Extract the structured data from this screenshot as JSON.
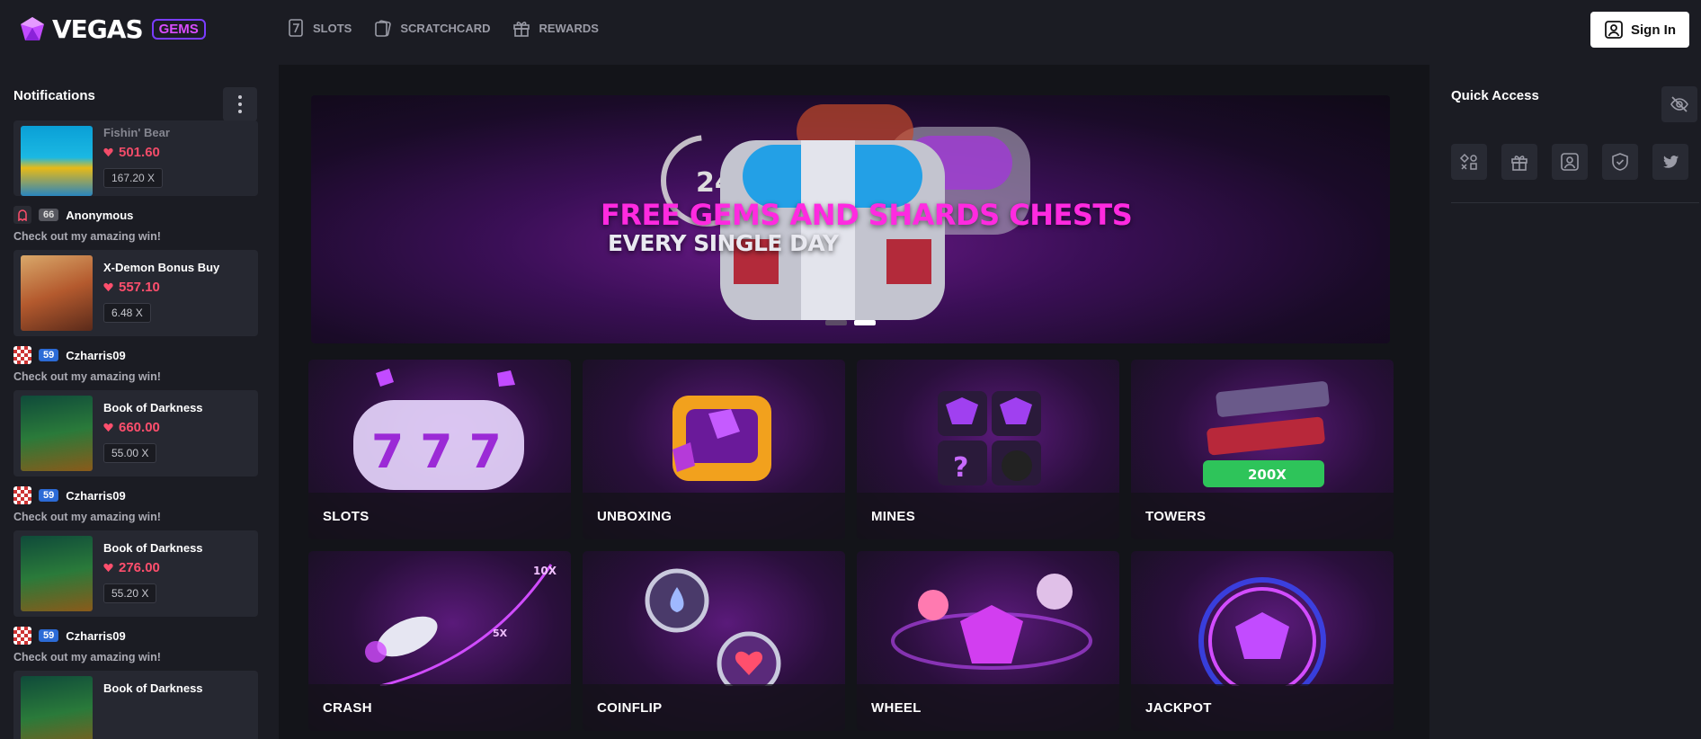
{
  "header": {
    "logo_text": "VEGAS",
    "logo_badge": "GEMS",
    "nav": [
      {
        "label": "SLOTS",
        "icon": "slot-seven-icon"
      },
      {
        "label": "SCRATCHCARD",
        "icon": "scratchcard-icon"
      },
      {
        "label": "REWARDS",
        "icon": "gift-icon"
      }
    ],
    "signin_label": "Sign In"
  },
  "notifications": {
    "title": "Notifications",
    "items": [
      {
        "user": "",
        "level": "",
        "message": "",
        "game": "Fishin' Bear",
        "amount": "501.60",
        "multiplier": "167.20 X"
      },
      {
        "user": "Anonymous",
        "level": "66",
        "message": "Check out my amazing win!",
        "game": "X-Demon Bonus Buy",
        "amount": "557.10",
        "multiplier": "6.48 X"
      },
      {
        "user": "Czharris09",
        "level": "59",
        "message": "Check out my amazing win!",
        "game": "Book of Darkness",
        "amount": "660.00",
        "multiplier": "55.00 X"
      },
      {
        "user": "Czharris09",
        "level": "59",
        "message": "Check out my amazing win!",
        "game": "Book of Darkness",
        "amount": "276.00",
        "multiplier": "55.20 X"
      },
      {
        "user": "Czharris09",
        "level": "59",
        "message": "Check out my amazing win!",
        "game": "Book of Darkness",
        "amount": "",
        "multiplier": ""
      }
    ]
  },
  "banner": {
    "title": "FREE GEMS AND SHARDS CHESTS",
    "subtitle": "EVERY SINGLE DAY",
    "badge": "24",
    "active_slide": 2,
    "slides": 2
  },
  "games": [
    {
      "label": "SLOTS"
    },
    {
      "label": "UNBOXING"
    },
    {
      "label": "MINES"
    },
    {
      "label": "TOWERS"
    },
    {
      "label": "CRASH"
    },
    {
      "label": "COINFLIP"
    },
    {
      "label": "WHEEL"
    },
    {
      "label": "JACKPOT"
    }
  ],
  "quick_access": {
    "title": "Quick Access",
    "buttons": [
      "games-icon",
      "gift-icon",
      "user-icon",
      "shield-icon",
      "twitter-icon"
    ],
    "toggle_icon": "eye-off-icon"
  },
  "colors": {
    "accent_pink": "#ff2ae0",
    "win_red": "#ff4f6d",
    "badge_purple": "#7a3cff",
    "level_blue": "#2c6bd6",
    "panel_bg": "#1b1c23",
    "page_bg": "#131419"
  }
}
